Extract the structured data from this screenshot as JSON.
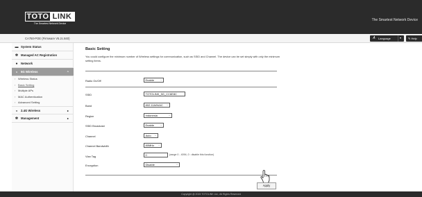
{
  "header": {
    "logo": {
      "word1": "TOTO",
      "word2": "LINK",
      "tagline": "The Smartest Network Device"
    },
    "slogan": "The Smartest Network Device",
    "device": "CA750-POE (Firmware V5.2c.840)",
    "language_label": "Language",
    "help_label": "Help"
  },
  "sidebar": {
    "items": [
      {
        "label": "System Status",
        "icon": "monitor-icon"
      },
      {
        "label": "Managed AC Registration",
        "icon": "gear-icon"
      },
      {
        "label": "Network",
        "icon": "globe-icon"
      },
      {
        "label": "5G Wireless",
        "icon": "wifi-icon",
        "arrow": "^",
        "active": true
      },
      {
        "label": "2.4G Wireless",
        "icon": "wifi-icon",
        "arrow": "▸"
      },
      {
        "label": "Management",
        "icon": "gear-icon",
        "arrow": "▸"
      }
    ],
    "sub_items": [
      {
        "label": "Wireless Status"
      },
      {
        "label": "Basic Setting",
        "current": true
      },
      {
        "label": "Multiple APs"
      },
      {
        "label": "MAC Authentication"
      },
      {
        "label": "Advanced Setting"
      }
    ]
  },
  "main": {
    "title": "Basic Setting",
    "description": "You could configure the minimum number of Wireless settings for communication, such as SSID and Channel. The device can be set simply with only the minimum setting items.",
    "radio": {
      "label": "Radio On/Off",
      "value": "Enable"
    },
    "fields": {
      "ssid": {
        "label": "SSID",
        "value": "TOTOLINK_5G_CC6E8C"
      },
      "band": {
        "label": "Band",
        "value": "802.11A/N/AC"
      },
      "region": {
        "label": "Region",
        "value": "Indonesia"
      },
      "ssid_broadcast": {
        "label": "SSID Broadcast",
        "value": "Enable"
      },
      "channel": {
        "label": "Channel",
        "value": "Auto"
      },
      "bandwidth": {
        "label": "Channel Bandwidth",
        "value": "80MHz"
      },
      "vlan": {
        "label": "Vlan Tag",
        "value": "0",
        "hint": "(range 0 - 4094, 0 : disable this function)"
      },
      "encryption": {
        "label": "Encryption",
        "value": "Disable"
      }
    },
    "apply_label": "Apply"
  },
  "footer": {
    "copyright": "Copyright @ 2015 TOTOLINK Ltd., All Rights Reserved"
  }
}
